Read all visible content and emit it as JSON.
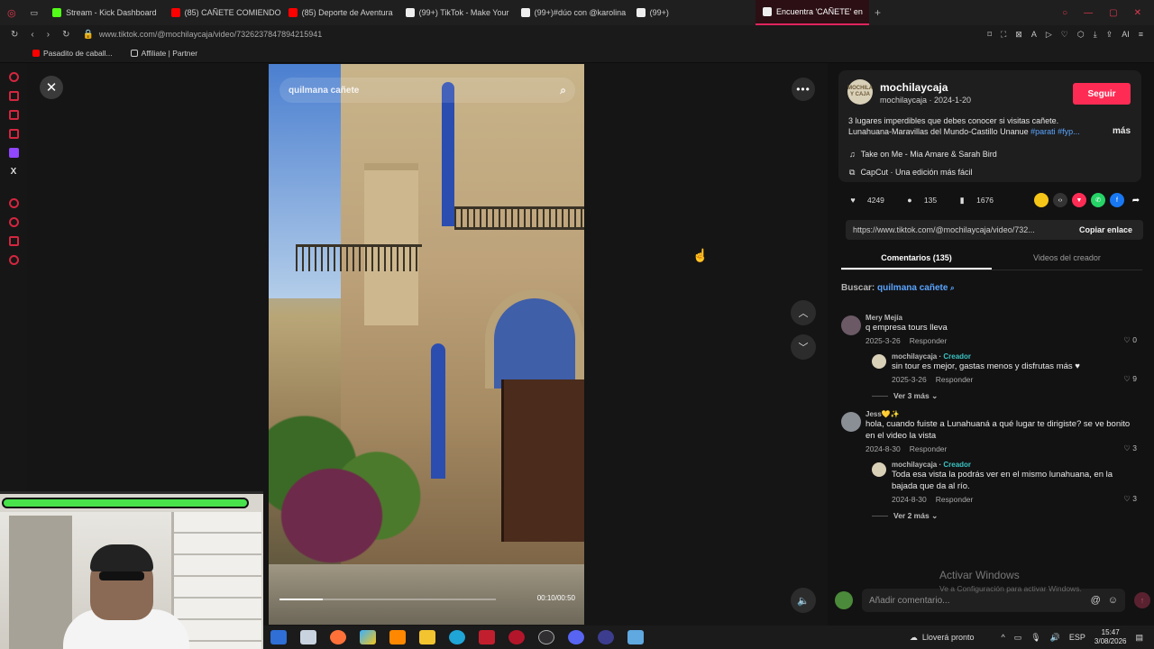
{
  "browser": {
    "tabs": [
      {
        "label": "Stream - Kick Dashboard",
        "color": "#53fc18"
      },
      {
        "label": "(85) CAÑETE COMIENDO",
        "color": "#ff0000"
      },
      {
        "label": "(85) Deporte de Aventura",
        "color": "#ff0000"
      },
      {
        "label": "(99+) TikTok - Make Your",
        "color": "#eeeeee"
      },
      {
        "label": "(99+)#dúo con @karolina",
        "color": "#eeeeee"
      },
      {
        "label": "(99+)",
        "color": "#eeeeee"
      },
      {
        "label": "Encuentra 'CAÑETE' en",
        "color": "#eeeeee",
        "active": true
      }
    ],
    "url": "www.tiktok.com/@mochilaycaja/video/7326237847894215941",
    "bookmarks": [
      "Pasadito de caball...",
      "Affiliate | Partner"
    ]
  },
  "video": {
    "search_text": "quilmana cañete",
    "time": "00:10/00:50",
    "progress_fraction": 0.2
  },
  "post": {
    "avatar_text": "MOCHILA Y CAJA",
    "username": "mochilaycaja",
    "sub": "mochilaycaja · 2024-1-20",
    "follow_label": "Seguir",
    "description": "3 lugares imperdibles que debes conocer si visitas cañete. Lunahuana-Maravillas del Mundo-Castillo Unanue",
    "tags": "#parati #fyp...",
    "more_label": "más",
    "music": "Take on Me - Mia Amare & Sarah Bird",
    "capcut": "CapCut · Una edición más fácil",
    "likes": "4249",
    "comments_count": "135",
    "saves": "1676",
    "link": "https://www.tiktok.com/@mochilaycaja/video/732...",
    "copy_label": "Copiar enlace",
    "tab_comments": "Comentarios (135)",
    "tab_creator": "Videos del creador",
    "search_prefix": "Buscar:",
    "search_query": "quilmana cañete"
  },
  "comments": [
    {
      "name": "Mery Mejía",
      "text": "q empresa tours lleva",
      "date": "2025-3-26",
      "reply_label": "Responder",
      "likes": "0",
      "reply": false
    },
    {
      "name": "mochilaycaja",
      "creator": "Creador",
      "text": "sin tour es mejor, gastas menos y disfrutas más ♥",
      "date": "2025-3-26",
      "reply_label": "Responder",
      "likes": "9",
      "reply": true
    },
    {
      "name": "Jess💛✨",
      "text": "hola, cuando fuiste a Lunahuaná a qué lugar te dirigiste? se ve bonito en el video la vista",
      "date": "2024-8-30",
      "reply_label": "Responder",
      "likes": "3",
      "reply": false
    },
    {
      "name": "mochilaycaja",
      "creator": "Creador",
      "text": "Toda esa vista la podrás ver en el mismo lunahuana, en la bajada que da al río.",
      "date": "2024-8-30",
      "reply_label": "Responder",
      "likes": "3",
      "reply": true
    }
  ],
  "more_replies_1": "Ver 3 más",
  "more_replies_2": "Ver 2 más",
  "compose_placeholder": "Añadir comentario...",
  "windows_activation": {
    "title": "Activar Windows",
    "sub": "Ve a Configuración para activar Windows."
  },
  "taskbar": {
    "weather": "Lloverá pronto",
    "lang": "ESP",
    "time": "15:47",
    "date": "3/08/2026"
  }
}
